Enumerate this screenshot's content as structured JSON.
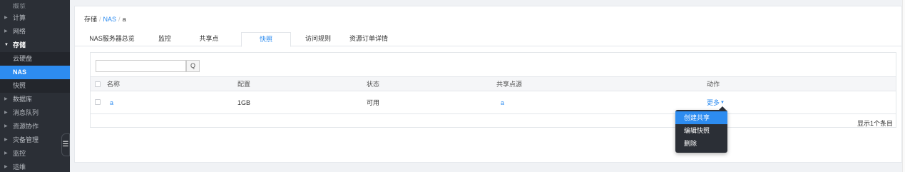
{
  "sidebar": {
    "items": [
      {
        "label": "概览"
      },
      {
        "label": "计算"
      },
      {
        "label": "网络"
      },
      {
        "label": "存储"
      },
      {
        "label": "云硬盘"
      },
      {
        "label": "NAS"
      },
      {
        "label": "快照"
      },
      {
        "label": "数据库"
      },
      {
        "label": "消息队列"
      },
      {
        "label": "资源协作"
      },
      {
        "label": "灾备管理"
      },
      {
        "label": "监控"
      },
      {
        "label": "运维"
      }
    ],
    "collapse_icon": "hamburger-icon"
  },
  "breadcrumb": {
    "root": "存储",
    "sep": "/",
    "level1": "NAS",
    "level2": "a"
  },
  "tabs": [
    {
      "label": "NAS服务器总览"
    },
    {
      "label": "监控"
    },
    {
      "label": "共享点"
    },
    {
      "label": "快照"
    },
    {
      "label": "访问规则"
    },
    {
      "label": "资源订单详情"
    }
  ],
  "search": {
    "placeholder": "",
    "icon": "search-icon",
    "icon_glyph": "Q"
  },
  "table": {
    "headers": {
      "name": "名称",
      "config": "配置",
      "status": "状态",
      "source": "共享点源",
      "actions": "动作"
    },
    "rows": [
      {
        "name": "a",
        "config": "1GB",
        "status": "可用",
        "source": "a",
        "action": "更多"
      }
    ],
    "footer": "显示1个条目"
  },
  "dropdown": {
    "items": [
      {
        "label": "创建共享"
      },
      {
        "label": "编辑快照"
      },
      {
        "label": "删除"
      }
    ]
  },
  "colors": {
    "accent": "#2d8cf0",
    "sidebar_bg": "#2b2f36"
  }
}
